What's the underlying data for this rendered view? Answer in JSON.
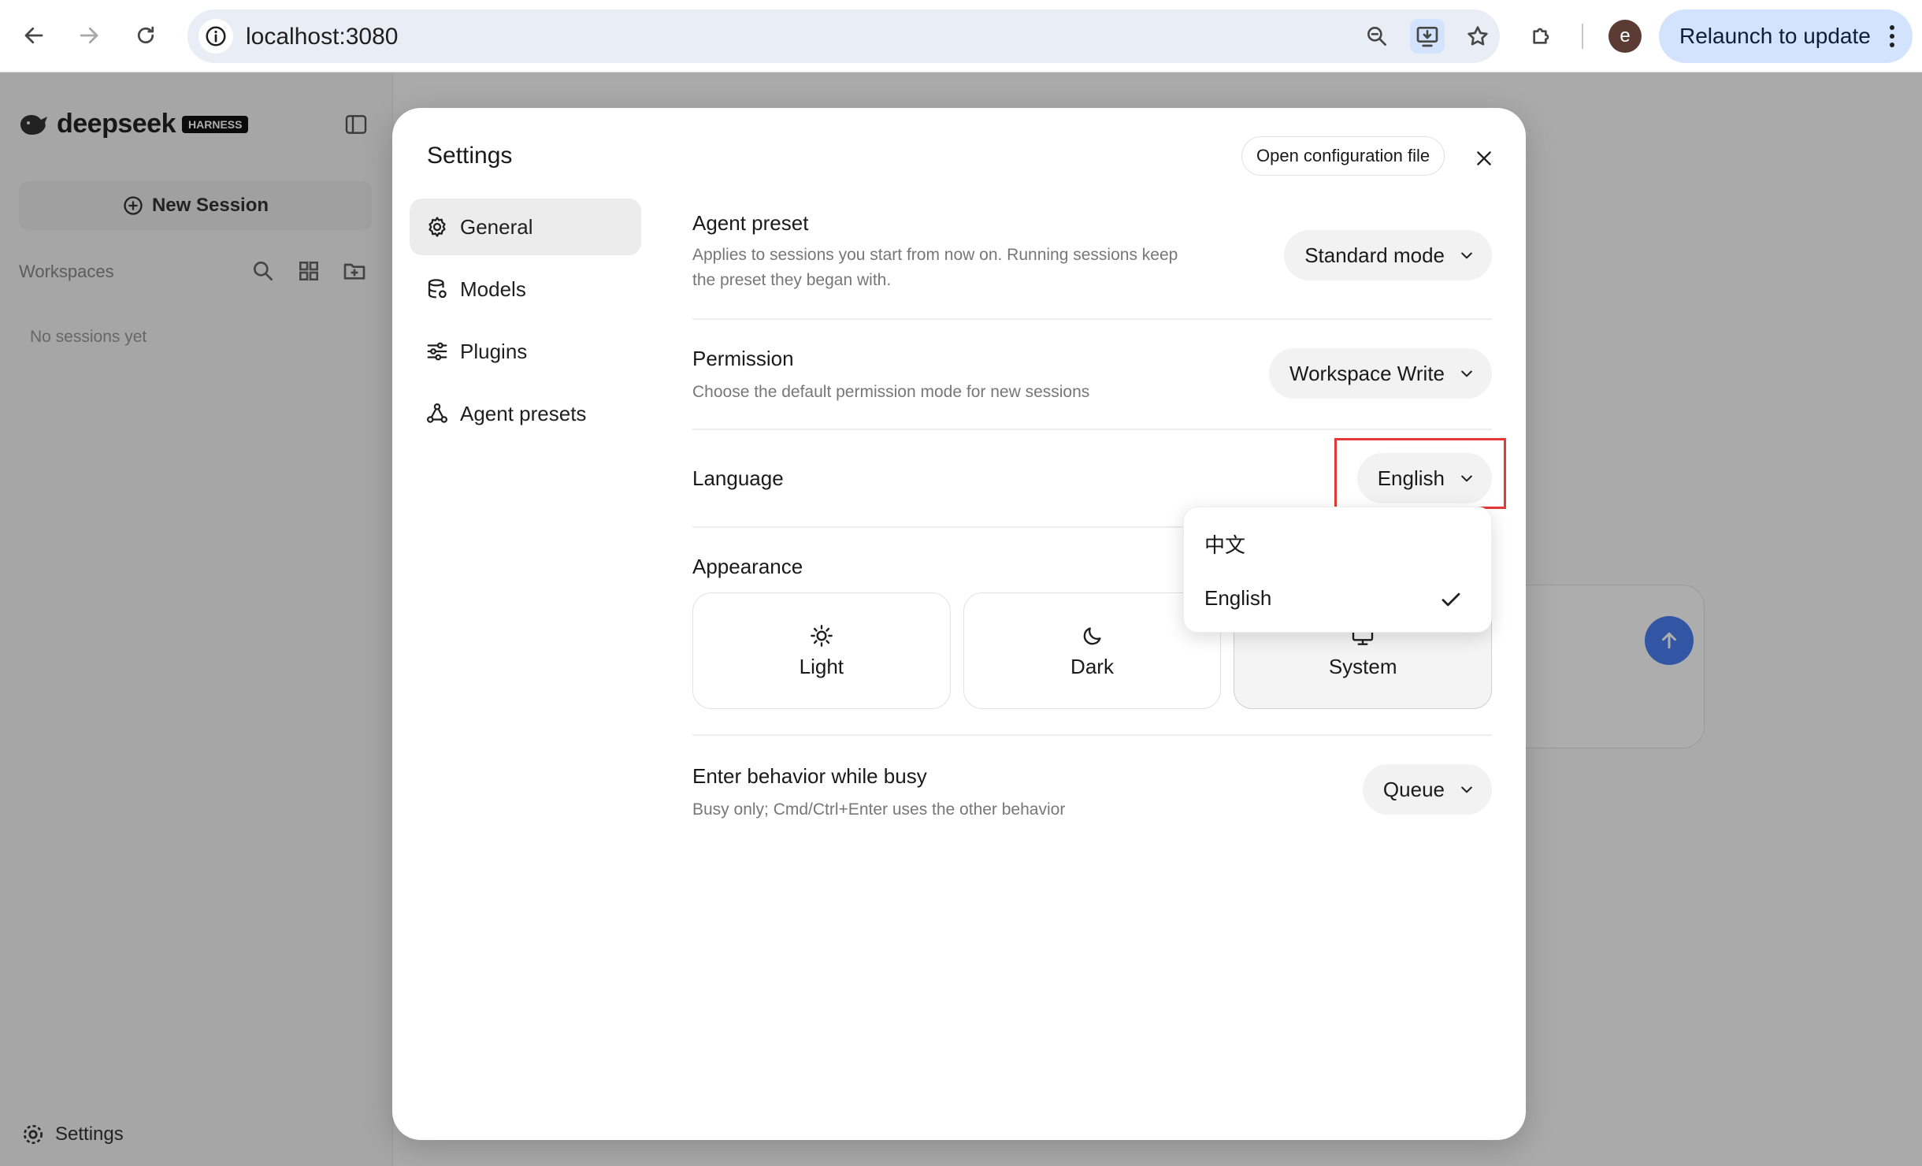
{
  "browser": {
    "url": "localhost:3080",
    "avatar_letter": "e",
    "relaunch_label": "Relaunch to update",
    "icons": [
      "back-arrow-icon",
      "forward-arrow-icon",
      "reload-icon",
      "site-info-icon",
      "zoom-icon",
      "install-app-icon",
      "bookmark-star-icon",
      "extensions-puzzle-icon",
      "kebab-menu-icon"
    ]
  },
  "sidebar": {
    "logo_text": "deepseek",
    "logo_badge": "HARNESS",
    "new_session_label": "New Session",
    "workspaces_label": "Workspaces",
    "empty_text": "No sessions yet",
    "settings_label": "Settings"
  },
  "modal": {
    "title": "Settings",
    "open_config_label": "Open configuration file",
    "nav": [
      {
        "label": "General",
        "icon": "gear-icon",
        "active": true
      },
      {
        "label": "Models",
        "icon": "database-icon",
        "active": false
      },
      {
        "label": "Plugins",
        "icon": "sliders-icon",
        "active": false
      },
      {
        "label": "Agent presets",
        "icon": "agent-nodes-icon",
        "active": false
      }
    ],
    "agent_preset": {
      "title": "Agent preset",
      "desc": "Applies to sessions you start from now on. Running sessions keep the preset they began with.",
      "value": "Standard mode"
    },
    "permission": {
      "title": "Permission",
      "desc": "Choose the default permission mode for new sessions",
      "value": "Workspace Write"
    },
    "language": {
      "title": "Language",
      "value": "English",
      "options": [
        "中文",
        "English"
      ],
      "selected": "English"
    },
    "appearance": {
      "title": "Appearance",
      "options": [
        {
          "label": "Light",
          "icon": "sun-icon"
        },
        {
          "label": "Dark",
          "icon": "moon-icon"
        },
        {
          "label": "System",
          "icon": "monitor-icon"
        }
      ],
      "selected": "System"
    },
    "enter_behavior": {
      "title": "Enter behavior while busy",
      "desc": "Busy only; Cmd/Ctrl+Enter uses the other behavior",
      "value": "Queue"
    }
  },
  "colors": {
    "highlight": "#e53935",
    "relaunch_bg": "#d3e3fd",
    "send_button": "#4a7ff0"
  }
}
